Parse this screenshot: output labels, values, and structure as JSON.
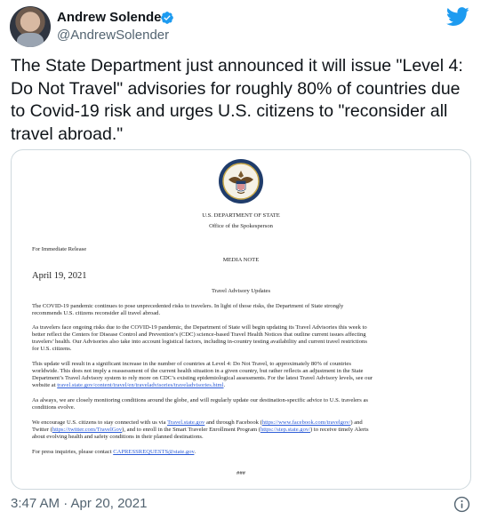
{
  "author": {
    "display_name": "Andrew Solender",
    "handle": "@AndrewSolender",
    "verified_icon": "verified-badge-icon"
  },
  "brand": {
    "icon": "twitter-bird-icon",
    "color": "#1d9bf0"
  },
  "tweet": {
    "text": "The State Department just announced it will issue \"Level 4: Do Not Travel\" advisories for roughly 80% of countries due to Covid-19 risk and urges U.S. citizens to \"reconsider all travel abroad.\"",
    "timestamp": "3:47 AM · Apr 20, 2021"
  },
  "document": {
    "seal_icon": "state-department-seal-icon",
    "department": "U.S. DEPARTMENT OF STATE",
    "office": "Office of the Spokesperson",
    "release": "For Immediate Release",
    "note_type": "MEDIA NOTE",
    "date": "April 19, 2021",
    "title": "Travel Advisory Updates",
    "p1_l1": "The COVID-19 pandemic continues to pose unprecedented risks to travelers. In light of those risks, the Department of State strongly",
    "p1_l2": "recommends U.S. citizens reconsider all travel abroad.",
    "p2_l1": "As travelers face ongoing risks due to the COVID-19 pandemic, the Department of State will begin updating its Travel Advisories this week to",
    "p2_l2": "better reflect the Centers for Disease Control and Prevention’s (CDC) science-based Travel Health Notices that outline current issues affecting",
    "p2_l3": "travelers’ health. Our Advisories also take into account logistical factors, including in-country testing availability and current travel restrictions",
    "p2_l4": "for U.S. citizens.",
    "p3_l1": "This update will result in a significant increase in the number of countries at Level 4: Do Not Travel, to approximately 80% of countries",
    "p3_l2": "worldwide. This does not imply a reassessment of the current health situation in a given country, but rather reflects an adjustment in the State",
    "p3_l3": "Department’s Travel Advisory system to rely more on CDC’s existing epidemiological assessments. For the latest Travel Advisory levels, see our",
    "p3_l4_pre": "website at ",
    "p3_l4_link": "travel.state.gov/content/travel/en/traveladvisories/traveladvisories.html",
    "p3_l4_post": ".",
    "p4_l1": "As always, we are closely monitoring conditions around the globe, and will regularly update our destination-specific advice to U.S. travelers as",
    "p4_l2": "conditions evolve.",
    "p5_l1_pre": "We encourage U.S. citizens to stay connected with us via ",
    "p5_l1_link1": "Travel.state.gov",
    "p5_l1_mid": " and through Facebook (",
    "p5_l1_link2": "https://www.facebook.com/travelgov/",
    "p5_l1_post": ") and",
    "p5_l2_pre": "Twitter (",
    "p5_l2_link1": "https://twitter.com/TravelGov",
    "p5_l2_mid": "), and to enroll in the Smart Traveler Enrollment Program (",
    "p5_l2_link2": "https://step.state.gov/",
    "p5_l2_post": ") to receive timely Alerts",
    "p5_l3": "about evolving health and safety conditions in their planned destinations.",
    "p6_pre": "For press inquiries, please contact ",
    "p6_link": "CAPRESSREQUESTS@state.gov",
    "p6_post": ".",
    "end_mark": "###"
  },
  "footer": {
    "info_icon": "info-icon"
  }
}
